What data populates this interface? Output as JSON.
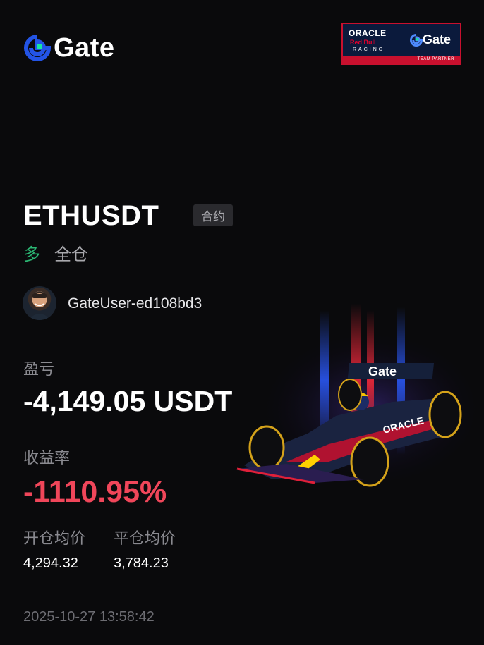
{
  "brand": {
    "logo_text": "Gate"
  },
  "partner_badge": {
    "line1": "ORACLE",
    "line2": "Red Bull",
    "line3": "RACING",
    "brand": "Gate",
    "footer": "TEAM PARTNER"
  },
  "position": {
    "pair": "ETHUSDT",
    "type_tag": "合约",
    "side": "多",
    "margin_mode": "全仓"
  },
  "user": {
    "name": "GateUser-ed108bd3"
  },
  "pnl": {
    "label": "盈亏",
    "value": "-4,149.05 USDT"
  },
  "roi": {
    "label": "收益率",
    "value": "-1110.95%"
  },
  "prices": {
    "open_label": "开仓均价",
    "open_value": "4,294.32",
    "close_label": "平仓均价",
    "close_value": "3,784.23"
  },
  "timestamp": "2025-10-27 13:58:42",
  "colors": {
    "background": "#0a0a0c",
    "long_green": "#2bb673",
    "loss_red": "#f0465a",
    "gate_blue": "#2354e6",
    "gate_green": "#17e6a1"
  },
  "icons": [
    "gate-logo-icon",
    "user-avatar",
    "f1-car-illustration"
  ]
}
